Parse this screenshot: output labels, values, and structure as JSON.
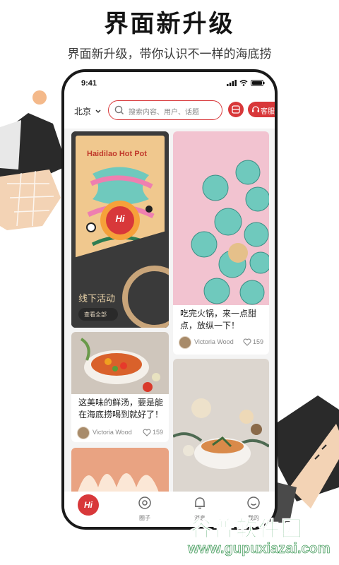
{
  "promo": {
    "headline": "界面新升级",
    "subline": "界面新升级，带你认识不一样的海底捞"
  },
  "status_bar": {
    "time": "9:41"
  },
  "top_bar": {
    "city": "北京",
    "search_placeholder": "搜索内容、用户、话题",
    "service_label": "客服"
  },
  "feed": {
    "event_card": {
      "poster_brand": "Haidilao Hot Pot",
      "title": "线下活动",
      "button_label": "查看全部"
    },
    "posts": [
      {
        "title": "吃完火锅，来一点甜点，放纵一下！",
        "author": "Victoria Wood",
        "likes": "159"
      },
      {
        "title": "这美味的鲜汤，要是能在海底捞喝到就好了！",
        "author": "Victoria Wood",
        "likes": "159"
      }
    ]
  },
  "tab_bar": {
    "tabs": [
      {
        "label": ""
      },
      {
        "label": "圈子"
      },
      {
        "label": "消息"
      },
      {
        "label": "我的"
      }
    ]
  },
  "watermark": {
    "title": "谷普软件园",
    "url": "www.gupuxiazai.com"
  },
  "colors": {
    "brand_red": "#d8383a",
    "poster_bg": "#f0c88e",
    "dessert_bg": "#f2c3d0",
    "frosting": "#6fc9bd"
  }
}
